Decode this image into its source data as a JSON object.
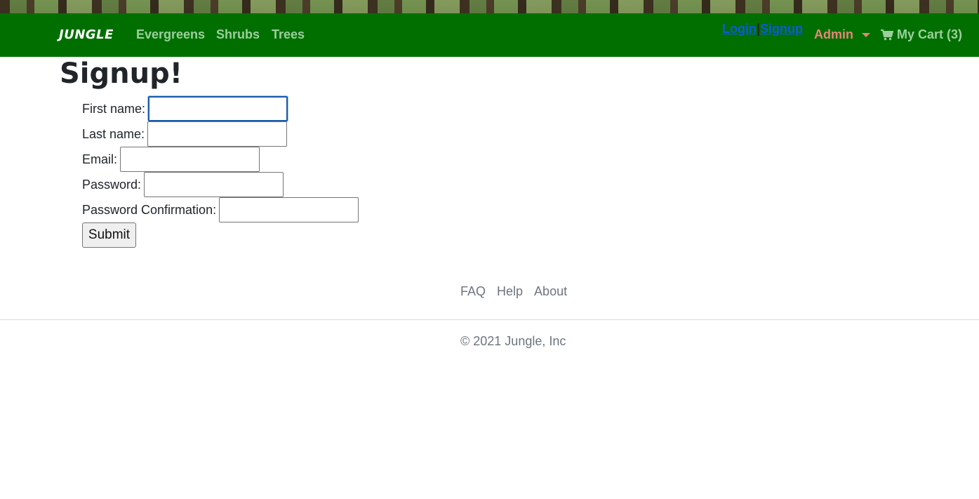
{
  "nav": {
    "brand": "JUNGLE",
    "links": [
      "Evergreens",
      "Shrubs",
      "Trees"
    ],
    "login": "Login",
    "separator": "|",
    "signup": "Signup",
    "admin": "Admin",
    "cart": "My Cart (3)"
  },
  "page": {
    "title": "Signup!"
  },
  "form": {
    "first_name_label": "First name:",
    "last_name_label": "Last name:",
    "email_label": "Email:",
    "password_label": "Password:",
    "password_confirmation_label": "Password Confirmation:",
    "first_name_value": "",
    "last_name_value": "",
    "email_value": "",
    "password_value": "",
    "password_confirmation_value": "",
    "submit_label": "Submit"
  },
  "footer": {
    "links": [
      "FAQ",
      "Help",
      "About"
    ],
    "copyright": "© 2021 Jungle, Inc"
  },
  "colors": {
    "navbar": "#006f00",
    "nav_link": "#9ccf9c",
    "auth_link": "#0a5bd8",
    "admin": "#e7857a"
  },
  "icons": {
    "cart": "shopping-cart-icon",
    "admin_dropdown": "caret-down-icon"
  }
}
